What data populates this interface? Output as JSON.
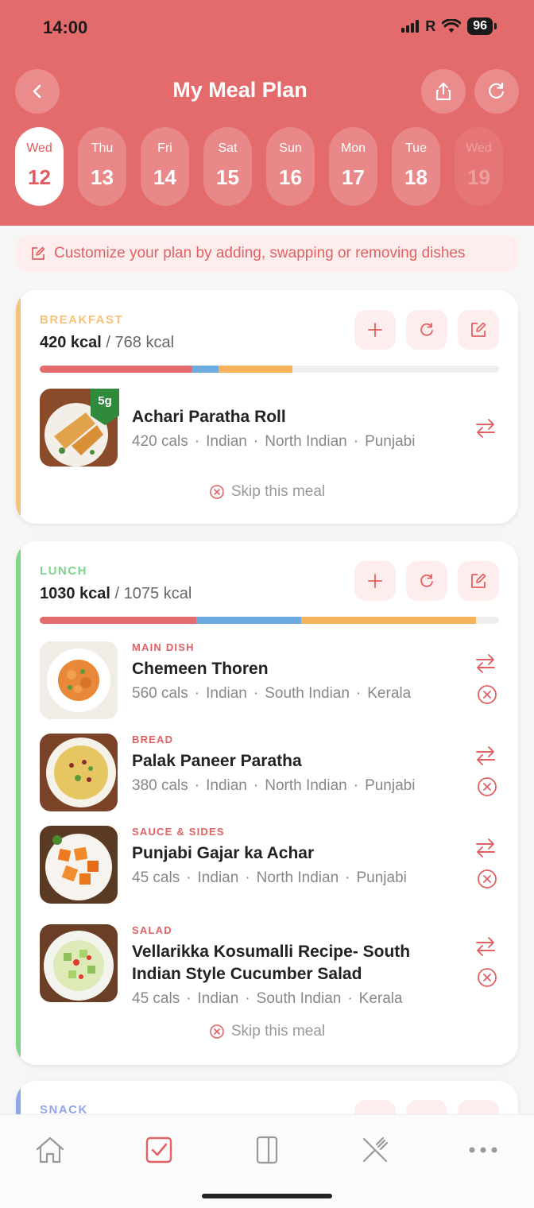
{
  "status": {
    "time": "14:00",
    "carrier": "R",
    "battery": "96"
  },
  "header": {
    "title": "My Meal Plan"
  },
  "days": [
    {
      "name": "Wed",
      "num": "12",
      "active": true
    },
    {
      "name": "Thu",
      "num": "13"
    },
    {
      "name": "Fri",
      "num": "14"
    },
    {
      "name": "Sat",
      "num": "15"
    },
    {
      "name": "Sun",
      "num": "16"
    },
    {
      "name": "Mon",
      "num": "17"
    },
    {
      "name": "Tue",
      "num": "18"
    },
    {
      "name": "Wed",
      "num": "19",
      "faded": true
    }
  ],
  "customize": "Customize your plan by adding, swapping or removing dishes",
  "colors": {
    "primary": "#e46b6c",
    "breakfast": "#f5c27a",
    "lunch": "#7fd68a",
    "snack": "#8fa6e8",
    "bar_red": "#e46b6c",
    "bar_blue": "#6cabe0",
    "bar_orange": "#f5b25b"
  },
  "breakfast": {
    "label": "BREAKFAST",
    "kcal": "420 kcal",
    "target": "/ 768 kcal",
    "progress": {
      "red": 0.33,
      "blue": 0.06,
      "orange": 0.16
    },
    "badge": "5g",
    "dish": {
      "name": "Achari Paratha Roll",
      "cals": "420 cals",
      "tags": [
        "Indian",
        "North Indian",
        "Punjabi"
      ]
    },
    "skip": "Skip this meal"
  },
  "lunch": {
    "label": "LUNCH",
    "kcal": "1030 kcal",
    "target": "/ 1075 kcal",
    "progress": {
      "red": 0.34,
      "blue": 0.23,
      "orange": 0.38
    },
    "dishes": [
      {
        "cat": "MAIN DISH",
        "name": "Chemeen Thoren",
        "cals": "560 cals",
        "tags": [
          "Indian",
          "South Indian",
          "Kerala"
        ]
      },
      {
        "cat": "BREAD",
        "name": "Palak Paneer Paratha",
        "cals": "380 cals",
        "tags": [
          "Indian",
          "North Indian",
          "Punjabi"
        ]
      },
      {
        "cat": "SAUCE & SIDES",
        "name": "Punjabi Gajar ka Achar",
        "cals": "45 cals",
        "tags": [
          "Indian",
          "North Indian",
          "Punjabi"
        ]
      },
      {
        "cat": "SALAD",
        "name": "Vellarikka Kosumalli Recipe- South Indian Style Cucumber Salad",
        "cals": "45 cals",
        "tags": [
          "Indian",
          "South Indian",
          "Kerala"
        ]
      }
    ],
    "skip": "Skip this meal"
  },
  "snack": {
    "label": "SNACK"
  },
  "nav": [
    "home-icon",
    "checklist-icon",
    "book-icon",
    "utensils-icon",
    "more-icon"
  ]
}
